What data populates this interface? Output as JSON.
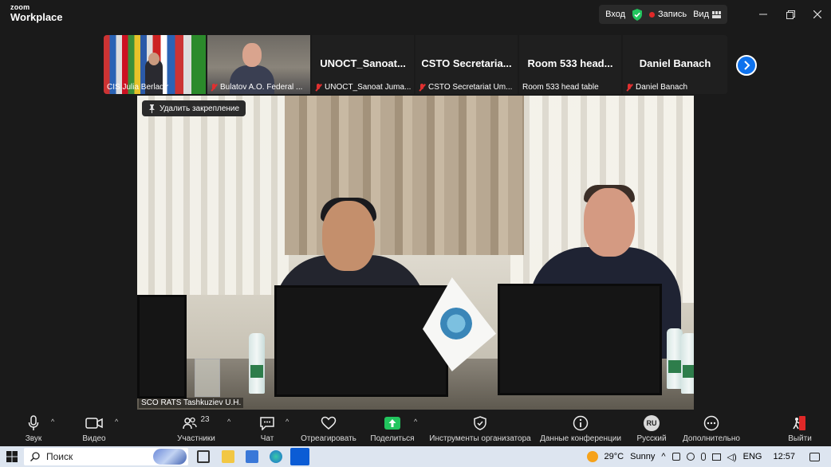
{
  "app": {
    "logo_line1": "zoom",
    "logo_line2": "Workplace"
  },
  "titlebar": {
    "signin": "Вход",
    "record": "Запись",
    "view": "Вид"
  },
  "gallery": [
    {
      "caption": "CIS Julia Berladir",
      "big": "",
      "muted": false
    },
    {
      "caption": "Bulatov A.O. Federal ...",
      "big": "",
      "muted": true
    },
    {
      "caption": "UNOCT_Sanoat Juma...",
      "big": "UNOCT_Sanoat...",
      "muted": true
    },
    {
      "caption": "CSTO Secretariat Um...",
      "big": "CSTO  Secretaria...",
      "muted": true
    },
    {
      "caption": "Room 533 head table",
      "big": "Room 533 head...",
      "muted": false
    },
    {
      "caption": "Daniel Banach",
      "big": "Daniel Banach",
      "muted": true
    }
  ],
  "main_video": {
    "speaker_label": "SCO RATS Tashkuziev U.H.",
    "unpin_label": "Удалить закрепление"
  },
  "toolbar": {
    "audio": "Звук",
    "video": "Видео",
    "participants": "Участники",
    "participants_count": "23",
    "chat": "Чат",
    "react": "Отреагировать",
    "share": "Поделиться",
    "host_tools": "Инструменты организатора",
    "meeting_info": "Данные конференции",
    "language": "Русский",
    "language_badge": "RU",
    "more": "Дополнительно",
    "leave": "Выйти"
  },
  "taskbar": {
    "search_placeholder": "Поиск",
    "temperature": "29°C",
    "weather": "Sunny",
    "lang": "ENG",
    "time": "12:57"
  },
  "colors": {
    "accent": "#0e72ed",
    "share_green": "#22c55e",
    "record_red": "#e02828"
  }
}
